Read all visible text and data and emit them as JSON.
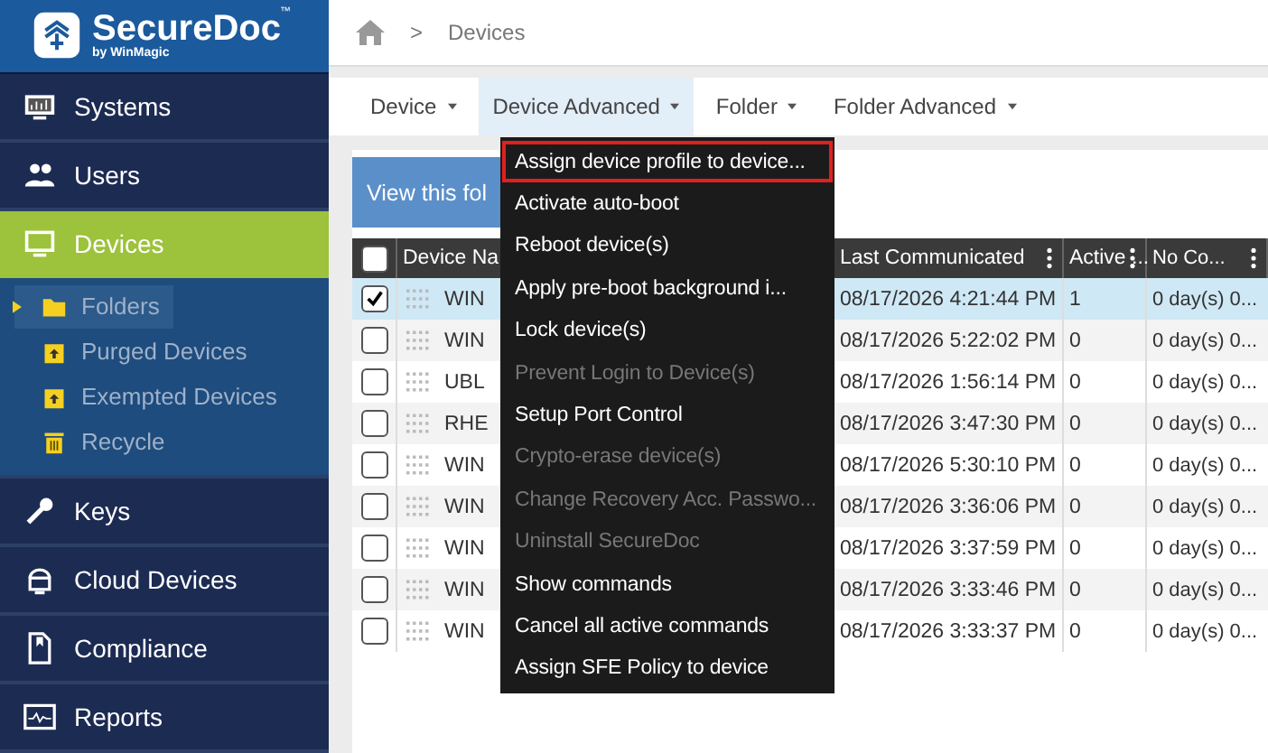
{
  "logo": {
    "name": "SecureDoc",
    "trademark": "™",
    "byline": "by WinMagic"
  },
  "sidebar": {
    "items": [
      {
        "label": "Systems",
        "selected": false
      },
      {
        "label": "Users",
        "selected": false
      },
      {
        "label": "Devices",
        "selected": true,
        "children": [
          {
            "label": "Folders",
            "selected": true
          },
          {
            "label": "Purged Devices",
            "selected": false
          },
          {
            "label": "Exempted Devices",
            "selected": false
          },
          {
            "label": "Recycle",
            "selected": false
          }
        ]
      },
      {
        "label": "Keys",
        "selected": false
      },
      {
        "label": "Cloud Devices",
        "selected": false
      },
      {
        "label": "Compliance",
        "selected": false
      },
      {
        "label": "Reports",
        "selected": false
      }
    ]
  },
  "breadcrumb": {
    "separator": ">",
    "current": "Devices"
  },
  "toolbar": [
    {
      "label": "Device",
      "selected": false
    },
    {
      "label": "Device Advanced",
      "selected": true
    },
    {
      "label": "Folder",
      "selected": false
    },
    {
      "label": "Folder Advanced",
      "selected": false
    }
  ],
  "view_button": "View this fol",
  "table": {
    "select_all_checked": false,
    "columns": [
      "Device Na",
      "",
      "Last Communicated",
      "Active ...",
      "No Co..."
    ],
    "rows": [
      {
        "checked": true,
        "name": "WIN",
        "last": "08/17/2026 4:21:44 PM",
        "active": "1",
        "noco": "0 day(s) 0..."
      },
      {
        "checked": false,
        "name": "WIN",
        "last": "08/17/2026 5:22:02 PM",
        "active": "0",
        "noco": "0 day(s) 0..."
      },
      {
        "checked": false,
        "name": "UBL",
        "last": "08/17/2026 1:56:14 PM",
        "active": "0",
        "noco": "0 day(s) 0..."
      },
      {
        "checked": false,
        "name": "RHE",
        "last": "08/17/2026 3:47:30 PM",
        "active": "0",
        "noco": "0 day(s) 0..."
      },
      {
        "checked": false,
        "name": "WIN",
        "last": "08/17/2026 5:30:10 PM",
        "active": "0",
        "noco": "0 day(s) 0..."
      },
      {
        "checked": false,
        "name": "WIN",
        "last": "08/17/2026 3:36:06 PM",
        "active": "0",
        "noco": "0 day(s) 0..."
      },
      {
        "checked": false,
        "name": "WIN",
        "last": "08/17/2026 3:37:59 PM",
        "active": "0",
        "noco": "0 day(s) 0..."
      },
      {
        "checked": false,
        "name": "WIN",
        "last": "08/17/2026 3:33:46 PM",
        "active": "0",
        "noco": "0 day(s) 0..."
      },
      {
        "checked": false,
        "name": "WIN",
        "last": "08/17/2026 3:33:37 PM",
        "active": "0",
        "noco": "0 day(s) 0..."
      }
    ]
  },
  "menu": [
    {
      "label": "Assign device profile to device...",
      "selected": true,
      "disabled": false
    },
    {
      "label": "Activate auto-boot",
      "selected": false,
      "disabled": false
    },
    {
      "label": "Reboot device(s)",
      "selected": false,
      "disabled": false
    },
    {
      "label": "Apply pre-boot background i...",
      "selected": false,
      "disabled": false
    },
    {
      "label": "Lock device(s)",
      "selected": false,
      "disabled": false
    },
    {
      "label": "Prevent Login to Device(s)",
      "selected": false,
      "disabled": true
    },
    {
      "label": "Setup Port Control",
      "selected": false,
      "disabled": false
    },
    {
      "label": "Crypto-erase device(s)",
      "selected": false,
      "disabled": true
    },
    {
      "label": "Change Recovery Acc. Passwo...",
      "selected": false,
      "disabled": true
    },
    {
      "label": "Uninstall SecureDoc",
      "selected": false,
      "disabled": true
    },
    {
      "label": "Show commands",
      "selected": false,
      "disabled": false
    },
    {
      "label": "Cancel all active commands",
      "selected": false,
      "disabled": false
    },
    {
      "label": "Assign SFE Policy to device",
      "selected": false,
      "disabled": false
    }
  ]
}
